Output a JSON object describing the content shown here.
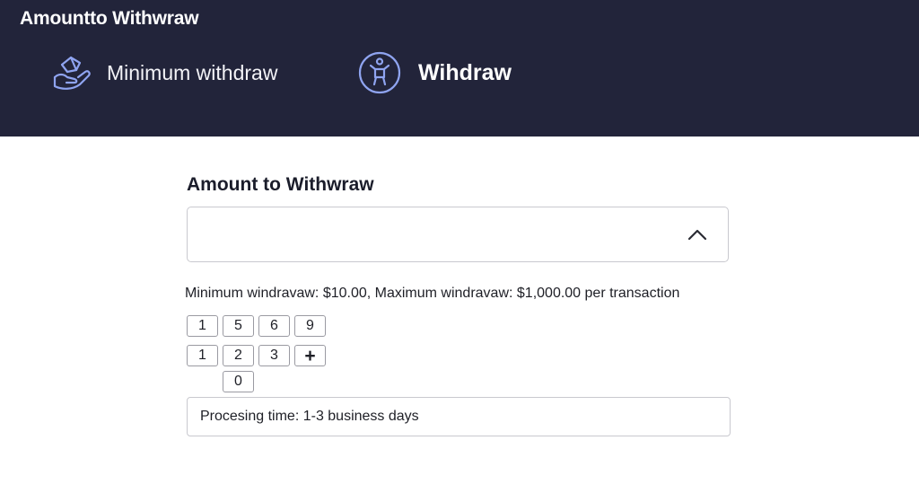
{
  "header": {
    "title": "Amountto Withwraw",
    "nav": [
      {
        "label": "Minimum withdraw",
        "icon": "hand-diamond-icon"
      },
      {
        "label": "Wihdraw",
        "icon": "person-circle-icon"
      }
    ]
  },
  "form": {
    "amount_label": "Amount to Withwraw",
    "amount_value": "",
    "limits_text": "Minimum windravaw: $10.00, Maximum windravaw: $1,000.00 per transaction",
    "keypad": [
      "1",
      "5",
      "6",
      "9",
      "1",
      "2",
      "3",
      "+",
      "0"
    ],
    "processing_text": "Procesing time: 1-3 business days"
  },
  "colors": {
    "header_bg": "#22243a",
    "icon_stroke": "#8fa4f0"
  }
}
